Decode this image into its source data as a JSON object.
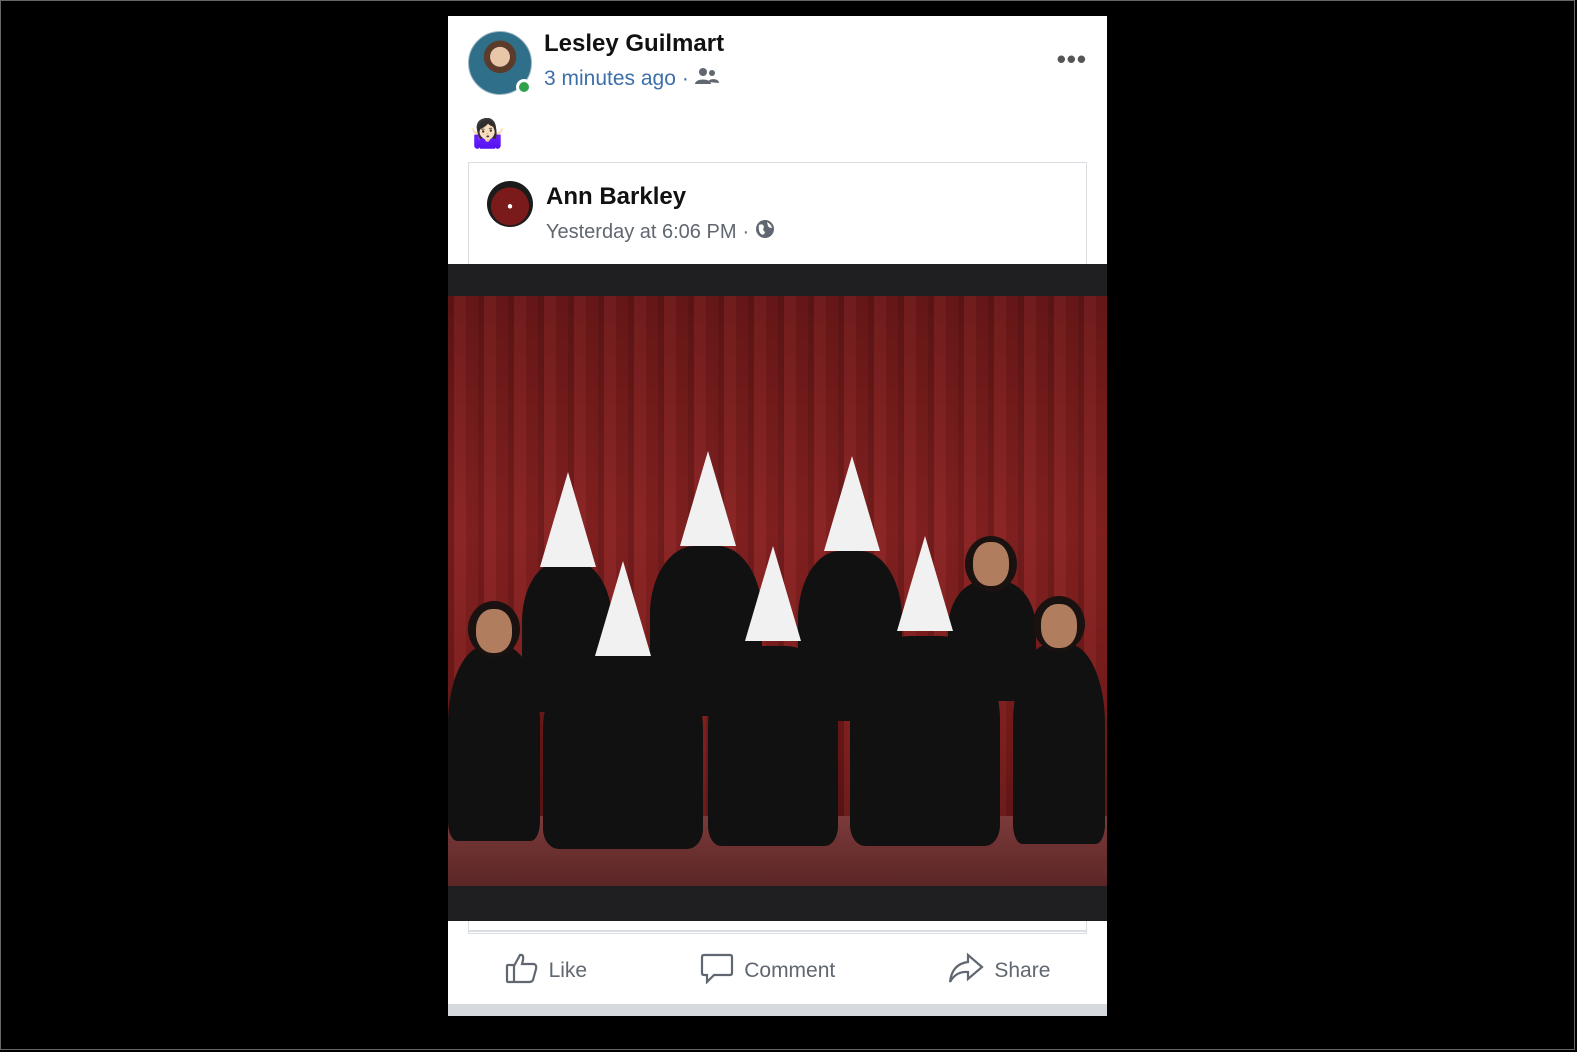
{
  "poster": {
    "name": "Lesley Guilmart",
    "timestamp": "3 minutes ago",
    "separator": "·",
    "audience_icon": "friends-icon"
  },
  "post": {
    "emoji": "🤷🏻‍♀️"
  },
  "shared": {
    "name": "Ann Barkley",
    "timestamp": "Yesterday at 6:06 PM",
    "separator": "·",
    "audience_icon": "globe-icon"
  },
  "actions": {
    "like": "Like",
    "comment": "Comment",
    "share": "Share"
  },
  "colors": {
    "online": "#31a24c",
    "link_blue": "#3c6fa8",
    "curtain": "#8a2222"
  }
}
